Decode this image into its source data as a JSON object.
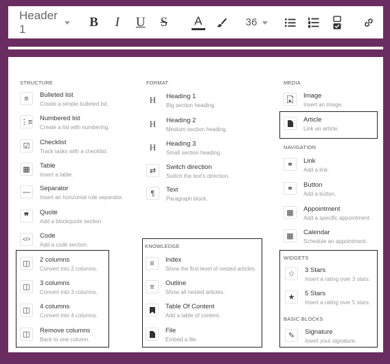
{
  "toolbar": {
    "heading_value": "Header 1",
    "bold": "B",
    "italic": "I",
    "underline": "U",
    "strike": "S",
    "text_color": "A",
    "font_size": "36"
  },
  "structure": {
    "title": "STRUCTURE",
    "items": [
      {
        "title": "Bulleted list",
        "desc": "Create a simple bulleted list.",
        "icon": "bulleted-list-icon"
      },
      {
        "title": "Numbered list",
        "desc": "Create a list with numbering.",
        "icon": "numbered-list-icon"
      },
      {
        "title": "Checklist",
        "desc": "Track tasks with a checklist.",
        "icon": "checklist-icon"
      },
      {
        "title": "Table",
        "desc": "Insert a table.",
        "icon": "table-icon"
      },
      {
        "title": "Separator",
        "desc": "Insert an horizontal rule separator.",
        "icon": "separator-icon"
      },
      {
        "title": "Quote",
        "desc": "Add a blockquote section.",
        "icon": "quote-icon"
      },
      {
        "title": "Code",
        "desc": "Add a code section.",
        "icon": "code-icon"
      },
      {
        "title": "2 columns",
        "desc": "Convert into 2 columns.",
        "icon": "columns-icon"
      },
      {
        "title": "3 columns",
        "desc": "Convert into 3 columns.",
        "icon": "columns-icon"
      },
      {
        "title": "4 columns",
        "desc": "Convert into 4 columns.",
        "icon": "columns-icon"
      },
      {
        "title": "Remove columns",
        "desc": "Back to one column.",
        "icon": "columns-icon"
      }
    ]
  },
  "format": {
    "title": "FORMAT",
    "items": [
      {
        "title": "Heading 1",
        "desc": "Big section heading.",
        "icon": "heading-icon",
        "glyph": "H"
      },
      {
        "title": "Heading 2",
        "desc": "Medium section heading.",
        "icon": "heading-icon",
        "glyph": "H"
      },
      {
        "title": "Heading 3",
        "desc": "Small section heading.",
        "icon": "heading-icon",
        "glyph": "H"
      },
      {
        "title": "Switch direction",
        "desc": "Switch the text's direction.",
        "icon": "switch-direction-icon"
      },
      {
        "title": "Text",
        "desc": "Paragraph block.",
        "icon": "paragraph-icon"
      }
    ]
  },
  "knowledge": {
    "title": "KNOWLEDGE",
    "items": [
      {
        "title": "Index",
        "desc": "Show the first level of nested articles.",
        "icon": "index-icon"
      },
      {
        "title": "Outline",
        "desc": "Show all nested articles.",
        "icon": "outline-icon"
      },
      {
        "title": "Table Of Content",
        "desc": "Add a table of content.",
        "icon": "bookmark-icon"
      },
      {
        "title": "File",
        "desc": "Embed a file.",
        "icon": "file-icon"
      }
    ]
  },
  "media": {
    "title": "MEDIA",
    "items": [
      {
        "title": "Image",
        "desc": "Insert an image.",
        "icon": "image-icon"
      },
      {
        "title": "Article",
        "desc": "Link an article.",
        "icon": "article-icon"
      }
    ]
  },
  "navigation": {
    "title": "NAVIGATION",
    "items": [
      {
        "title": "Link",
        "desc": "Add a link.",
        "icon": "link-icon"
      },
      {
        "title": "Button",
        "desc": "Add a button.",
        "icon": "link-icon"
      },
      {
        "title": "Appointment",
        "desc": "Add a specific appointment.",
        "icon": "calendar-icon"
      },
      {
        "title": "Calendar",
        "desc": "Schedule an appointment.",
        "icon": "calendar-icon"
      }
    ]
  },
  "widgets": {
    "title": "WIDGETS",
    "items": [
      {
        "title": "3 Stars",
        "desc": "Insert a rating over 3 stars.",
        "icon": "star-outline-icon"
      },
      {
        "title": "5 Stars",
        "desc": "Insert a rating over 5 stars.",
        "icon": "star-filled-icon"
      }
    ]
  },
  "basic_blocks": {
    "title": "BASIC BLOCKS",
    "items": [
      {
        "title": "Signature",
        "desc": "Insert your signature.",
        "icon": "signature-icon"
      }
    ]
  }
}
